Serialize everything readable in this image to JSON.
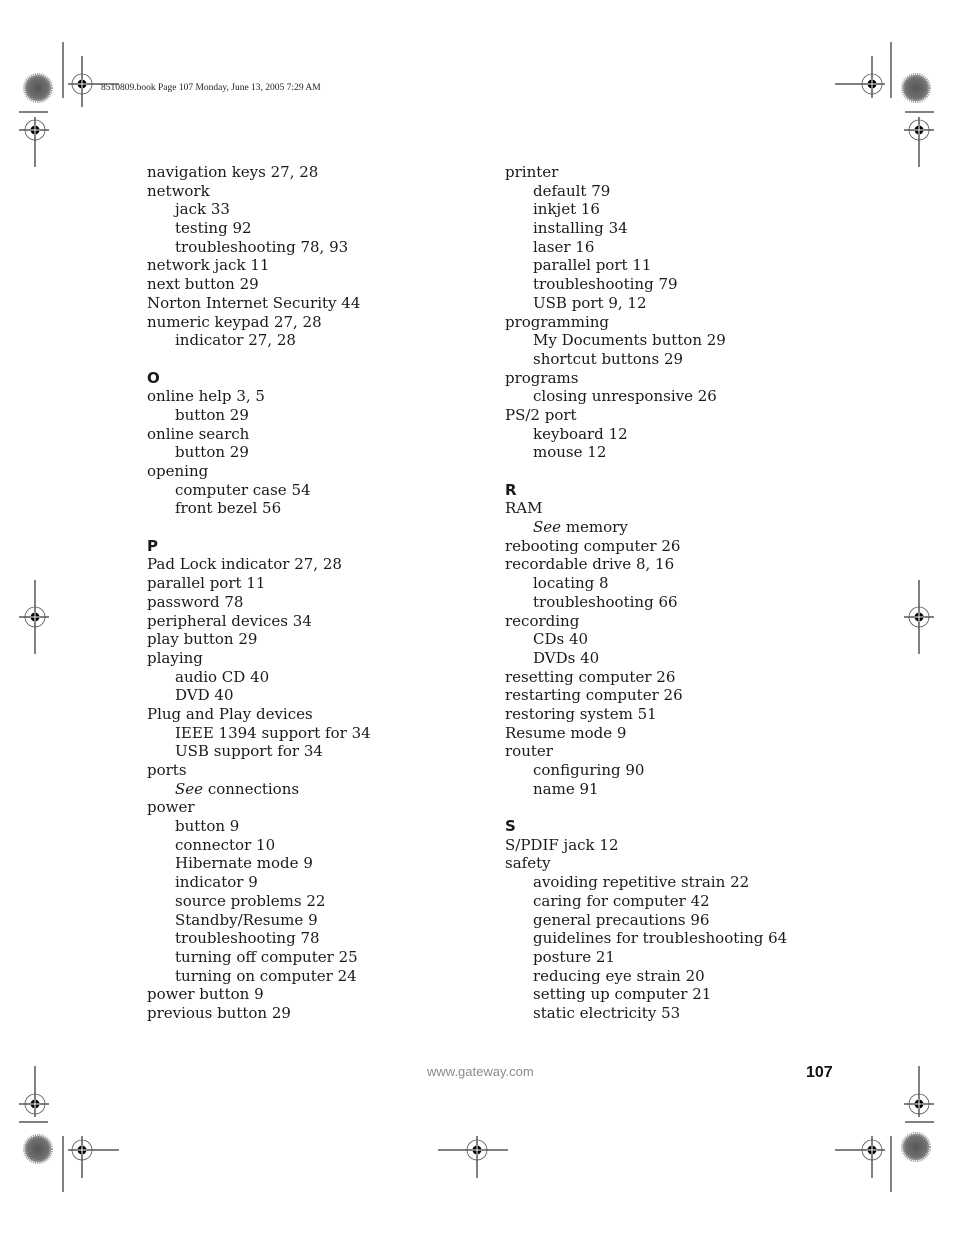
{
  "slug_line": "8510809.book  Page 107  Monday, June 13, 2005  7:29 AM",
  "left_column": [
    {
      "type": "entry",
      "level": 0,
      "term": "navigation keys",
      "pages": "27, 28"
    },
    {
      "type": "entry",
      "level": 0,
      "term": "network",
      "pages": ""
    },
    {
      "type": "entry",
      "level": 1,
      "term": "jack",
      "pages": "33"
    },
    {
      "type": "entry",
      "level": 1,
      "term": "testing",
      "pages": "92"
    },
    {
      "type": "entry",
      "level": 1,
      "term": "troubleshooting",
      "pages": "78, 93"
    },
    {
      "type": "entry",
      "level": 0,
      "term": "network jack",
      "pages": "11"
    },
    {
      "type": "entry",
      "level": 0,
      "term": "next button",
      "pages": "29"
    },
    {
      "type": "entry",
      "level": 0,
      "term": "Norton Internet Security",
      "pages": "44"
    },
    {
      "type": "entry",
      "level": 0,
      "term": "numeric keypad",
      "pages": "27, 28"
    },
    {
      "type": "entry",
      "level": 1,
      "term": "indicator",
      "pages": "27, 28"
    },
    {
      "type": "gap"
    },
    {
      "type": "letter",
      "text": "O"
    },
    {
      "type": "entry",
      "level": 0,
      "term": "online help",
      "pages": "3, 5"
    },
    {
      "type": "entry",
      "level": 1,
      "term": "button",
      "pages": "29"
    },
    {
      "type": "entry",
      "level": 0,
      "term": "online search",
      "pages": ""
    },
    {
      "type": "entry",
      "level": 1,
      "term": "button",
      "pages": "29"
    },
    {
      "type": "entry",
      "level": 0,
      "term": "opening",
      "pages": ""
    },
    {
      "type": "entry",
      "level": 1,
      "term": "computer case",
      "pages": "54"
    },
    {
      "type": "entry",
      "level": 1,
      "term": "front bezel",
      "pages": "56"
    },
    {
      "type": "gap"
    },
    {
      "type": "letter",
      "text": "P"
    },
    {
      "type": "entry",
      "level": 0,
      "term": "Pad Lock indicator",
      "pages": "27, 28"
    },
    {
      "type": "entry",
      "level": 0,
      "term": "parallel port",
      "pages": "11"
    },
    {
      "type": "entry",
      "level": 0,
      "term": "password",
      "pages": "78"
    },
    {
      "type": "entry",
      "level": 0,
      "term": "peripheral devices",
      "pages": "34"
    },
    {
      "type": "entry",
      "level": 0,
      "term": "play button",
      "pages": "29"
    },
    {
      "type": "entry",
      "level": 0,
      "term": "playing",
      "pages": ""
    },
    {
      "type": "entry",
      "level": 1,
      "term": "audio CD",
      "pages": "40"
    },
    {
      "type": "entry",
      "level": 1,
      "term": "DVD",
      "pages": "40"
    },
    {
      "type": "entry",
      "level": 0,
      "term": "Plug and Play devices",
      "pages": ""
    },
    {
      "type": "entry",
      "level": 1,
      "term": "IEEE 1394 support for",
      "pages": "34"
    },
    {
      "type": "entry",
      "level": 1,
      "term": "USB support for",
      "pages": "34"
    },
    {
      "type": "entry",
      "level": 0,
      "term": "ports",
      "pages": ""
    },
    {
      "type": "see",
      "level": 1,
      "see": "See",
      "term": "connections"
    },
    {
      "type": "entry",
      "level": 0,
      "term": "power",
      "pages": ""
    },
    {
      "type": "entry",
      "level": 1,
      "term": "button",
      "pages": "9"
    },
    {
      "type": "entry",
      "level": 1,
      "term": "connector",
      "pages": "10"
    },
    {
      "type": "entry",
      "level": 1,
      "term": "Hibernate mode",
      "pages": "9"
    },
    {
      "type": "entry",
      "level": 1,
      "term": "indicator",
      "pages": "9"
    },
    {
      "type": "entry",
      "level": 1,
      "term": "source problems",
      "pages": "22"
    },
    {
      "type": "entry",
      "level": 1,
      "term": "Standby/Resume",
      "pages": "9"
    },
    {
      "type": "entry",
      "level": 1,
      "term": "troubleshooting",
      "pages": "78"
    },
    {
      "type": "entry",
      "level": 1,
      "term": "turning off computer",
      "pages": "25"
    },
    {
      "type": "entry",
      "level": 1,
      "term": "turning on computer",
      "pages": "24"
    },
    {
      "type": "entry",
      "level": 0,
      "term": "power button",
      "pages": "9"
    },
    {
      "type": "entry",
      "level": 0,
      "term": "previous button",
      "pages": "29"
    }
  ],
  "right_column": [
    {
      "type": "entry",
      "level": 0,
      "term": "printer",
      "pages": ""
    },
    {
      "type": "entry",
      "level": 1,
      "term": "default",
      "pages": "79"
    },
    {
      "type": "entry",
      "level": 1,
      "term": "inkjet",
      "pages": "16"
    },
    {
      "type": "entry",
      "level": 1,
      "term": "installing",
      "pages": "34"
    },
    {
      "type": "entry",
      "level": 1,
      "term": "laser",
      "pages": "16"
    },
    {
      "type": "entry",
      "level": 1,
      "term": "parallel port",
      "pages": "11"
    },
    {
      "type": "entry",
      "level": 1,
      "term": "troubleshooting",
      "pages": "79"
    },
    {
      "type": "entry",
      "level": 1,
      "term": "USB port",
      "pages": "9, 12"
    },
    {
      "type": "entry",
      "level": 0,
      "term": "programming",
      "pages": ""
    },
    {
      "type": "entry",
      "level": 1,
      "term": "My Documents button",
      "pages": "29"
    },
    {
      "type": "entry",
      "level": 1,
      "term": "shortcut buttons",
      "pages": "29"
    },
    {
      "type": "entry",
      "level": 0,
      "term": "programs",
      "pages": ""
    },
    {
      "type": "entry",
      "level": 1,
      "term": "closing unresponsive",
      "pages": "26"
    },
    {
      "type": "entry",
      "level": 0,
      "term": "PS/2 port",
      "pages": ""
    },
    {
      "type": "entry",
      "level": 1,
      "term": "keyboard",
      "pages": "12"
    },
    {
      "type": "entry",
      "level": 1,
      "term": "mouse",
      "pages": "12"
    },
    {
      "type": "gap"
    },
    {
      "type": "letter",
      "text": "R"
    },
    {
      "type": "entry",
      "level": 0,
      "term": "RAM",
      "pages": ""
    },
    {
      "type": "see",
      "level": 1,
      "see": "See",
      "term": "memory"
    },
    {
      "type": "entry",
      "level": 0,
      "term": "rebooting computer",
      "pages": "26"
    },
    {
      "type": "entry",
      "level": 0,
      "term": "recordable drive",
      "pages": "8, 16"
    },
    {
      "type": "entry",
      "level": 1,
      "term": "locating",
      "pages": "8"
    },
    {
      "type": "entry",
      "level": 1,
      "term": "troubleshooting",
      "pages": "66"
    },
    {
      "type": "entry",
      "level": 0,
      "term": "recording",
      "pages": ""
    },
    {
      "type": "entry",
      "level": 1,
      "term": "CDs",
      "pages": "40"
    },
    {
      "type": "entry",
      "level": 1,
      "term": "DVDs",
      "pages": "40"
    },
    {
      "type": "entry",
      "level": 0,
      "term": "resetting computer",
      "pages": "26"
    },
    {
      "type": "entry",
      "level": 0,
      "term": "restarting computer",
      "pages": "26"
    },
    {
      "type": "entry",
      "level": 0,
      "term": "restoring system",
      "pages": "51"
    },
    {
      "type": "entry",
      "level": 0,
      "term": "Resume mode",
      "pages": "9"
    },
    {
      "type": "entry",
      "level": 0,
      "term": "router",
      "pages": ""
    },
    {
      "type": "entry",
      "level": 1,
      "term": "configuring",
      "pages": "90"
    },
    {
      "type": "entry",
      "level": 1,
      "term": "name",
      "pages": "91"
    },
    {
      "type": "gap"
    },
    {
      "type": "letter",
      "text": "S"
    },
    {
      "type": "entry",
      "level": 0,
      "term": "S/PDIF jack",
      "pages": "12"
    },
    {
      "type": "entry",
      "level": 0,
      "term": "safety",
      "pages": ""
    },
    {
      "type": "entry",
      "level": 1,
      "term": "avoiding repetitive strain",
      "pages": "22"
    },
    {
      "type": "entry",
      "level": 1,
      "term": "caring for computer",
      "pages": "42"
    },
    {
      "type": "entry",
      "level": 1,
      "term": "general precautions",
      "pages": "96"
    },
    {
      "type": "entry",
      "level": 1,
      "term": "guidelines for troubleshooting",
      "pages": "64"
    },
    {
      "type": "entry",
      "level": 1,
      "term": "posture",
      "pages": "21"
    },
    {
      "type": "entry",
      "level": 1,
      "term": "reducing eye strain",
      "pages": "20"
    },
    {
      "type": "entry",
      "level": 1,
      "term": "setting up computer",
      "pages": "21"
    },
    {
      "type": "entry",
      "level": 1,
      "term": "static electricity",
      "pages": "53"
    }
  ],
  "footer": {
    "url": "www.gateway.com",
    "page_number": "107"
  },
  "colors": {
    "text": "#1a1a1a",
    "footer_url": "#8a8a8a"
  }
}
